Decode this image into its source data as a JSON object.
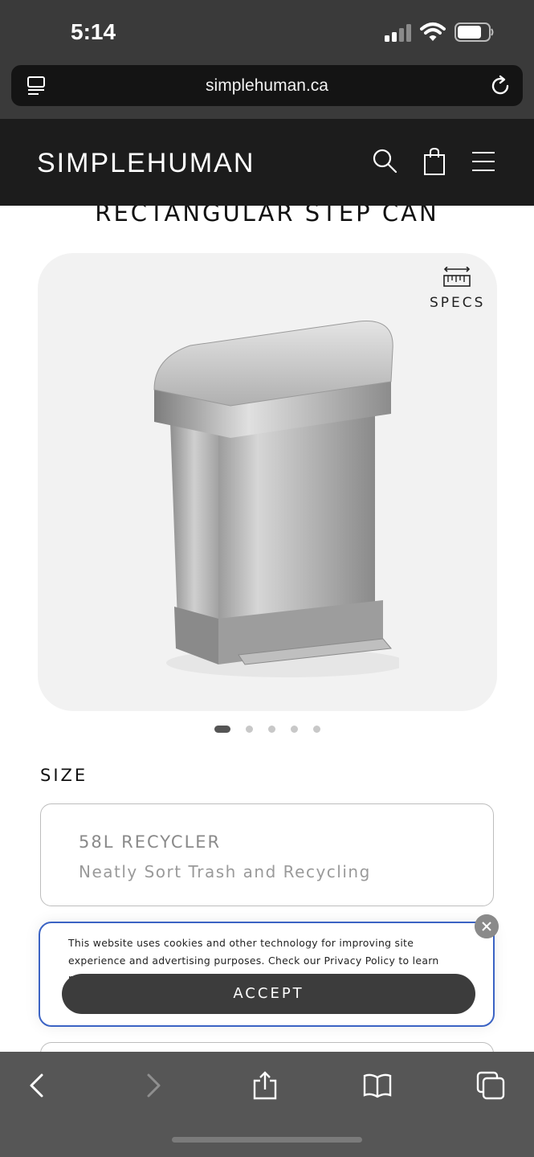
{
  "status_bar": {
    "time": "5:14",
    "signal-icon": "cellular-signal-icon",
    "wifi-icon": "wifi-icon",
    "battery-icon": "battery-icon"
  },
  "browser": {
    "url": "simplehuman.ca",
    "reader_icon": "reader-icon",
    "reload_icon": "reload-icon"
  },
  "site_header": {
    "logo": "SIMPLEHUMAN",
    "icons": [
      "search-icon",
      "bag-icon",
      "menu-icon"
    ]
  },
  "product": {
    "title": "RECTANGULAR STEP CAN",
    "specs_label": "SPECS"
  },
  "carousel": {
    "count": 5,
    "active_index": 0
  },
  "size": {
    "heading": "SIZE",
    "option": {
      "title": "58L RECYCLER",
      "subtitle": "Neatly Sort Trash and Recycling"
    }
  },
  "cookie_banner": {
    "text": "This website uses cookies and other technology for improving site experience and advertising purposes. Check our Privacy Policy to learn more.",
    "accept_label": "ACCEPT"
  },
  "toolbar": {
    "icons": [
      "back-icon",
      "forward-icon",
      "share-icon",
      "bookmarks-icon",
      "tabs-icon"
    ]
  },
  "colors": {
    "header_bg": "#1c1c1c",
    "card_bg": "#f2f2f2",
    "banner_border": "#3b63c4",
    "button_bg": "#3c3c3c"
  }
}
